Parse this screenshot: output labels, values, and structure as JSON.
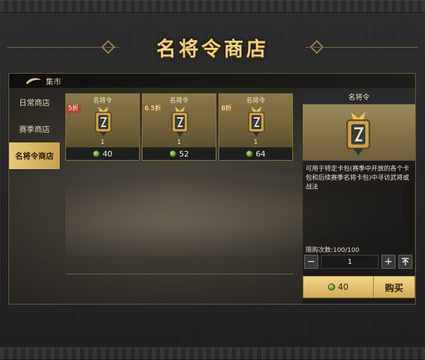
{
  "header": {
    "title": "名将令商店"
  },
  "panel": {
    "section_label": "集市"
  },
  "sidebar": {
    "tabs": [
      {
        "label": "日常商店",
        "active": false
      },
      {
        "label": "赛季商店",
        "active": false
      },
      {
        "label": "名将令商店",
        "active": true
      }
    ]
  },
  "items": [
    {
      "name": "名将令",
      "discount": "5折",
      "qty": "1",
      "price": "40"
    },
    {
      "name": "名将令",
      "discount": "6.5折",
      "qty": "1",
      "price": "52"
    },
    {
      "name": "名将令",
      "discount": "8折",
      "qty": "1",
      "price": "64"
    }
  ],
  "detail": {
    "title": "名将令",
    "description": "可用于特定卡包(赛季中开放的各个卡包和后续赛季名将卡包)中寻访武将或战法",
    "limit_text": "限购次数:100/100",
    "quantity": "1",
    "price": "40",
    "buy_label": "购买"
  },
  "colors": {
    "accent_gold": "#f2d27a",
    "discount_red": "#b8432c",
    "currency_jade": "#5a8c2a"
  }
}
